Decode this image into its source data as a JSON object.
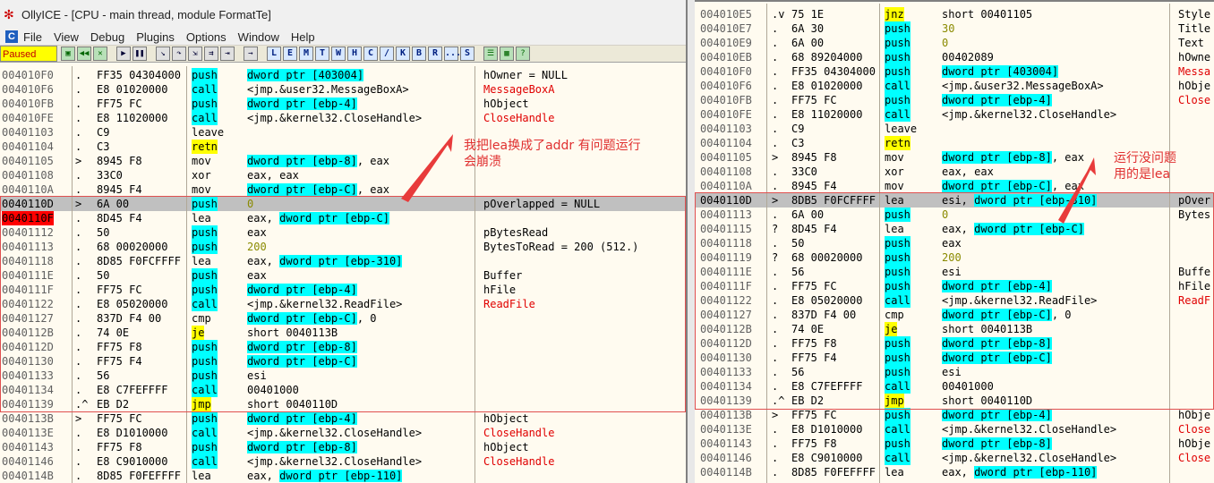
{
  "window": {
    "title": "OllyICE - [CPU - main thread, module FormatTe]",
    "menu": [
      "File",
      "View",
      "Debug",
      "Plugins",
      "Options",
      "Window",
      "Help"
    ],
    "status": "Paused",
    "toolbar_buttons": [
      "L",
      "E",
      "M",
      "T",
      "W",
      "H",
      "C",
      "/",
      "K",
      "B",
      "R",
      "...",
      "S"
    ]
  },
  "left_rows": [
    {
      "addr": "004010F0",
      "mk": ".",
      "hex": "FF35 04304000",
      "mn": "push",
      "op": "dword ptr [403004]",
      "cm": "hOwner = NULL"
    },
    {
      "addr": "004010F6",
      "mk": ".",
      "hex": "E8 01020000",
      "mn": "call",
      "op": "<jmp.&user32.MessageBoxA>",
      "cm": "MessageBoxA"
    },
    {
      "addr": "004010FB",
      "mk": ".",
      "hex": "FF75 FC",
      "mn": "push",
      "op": "dword ptr [ebp-4]",
      "cm": "hObject"
    },
    {
      "addr": "004010FE",
      "mk": ".",
      "hex": "E8 11020000",
      "mn": "call",
      "op": "<jmp.&kernel32.CloseHandle>",
      "cm": "CloseHandle"
    },
    {
      "addr": "00401103",
      "mk": ".",
      "hex": "C9",
      "mn": "leave",
      "op": "",
      "cm": ""
    },
    {
      "addr": "00401104",
      "mk": ".",
      "hex": "C3",
      "mn": "retn",
      "op": "",
      "cm": ""
    },
    {
      "addr": "00401105",
      "mk": ">",
      "hex": "8945 F8",
      "mn": "mov",
      "op": "dword ptr [ebp-8], eax",
      "cm": ""
    },
    {
      "addr": "00401108",
      "mk": ".",
      "hex": "33C0",
      "mn": "xor",
      "op": "eax, eax",
      "cm": ""
    },
    {
      "addr": "0040110A",
      "mk": ".",
      "hex": "8945 F4",
      "mn": "mov",
      "op": "dword ptr [ebp-C], eax",
      "cm": ""
    },
    {
      "addr": "0040110D",
      "mk": ">",
      "hex": "6A 00",
      "mn": "push",
      "op": "0",
      "cm": "pOverlapped = NULL"
    },
    {
      "addr": "0040110F",
      "mk": ".",
      "hex": "8D45 F4",
      "mn": "lea",
      "op": "eax, dword ptr [ebp-C]",
      "cm": ""
    },
    {
      "addr": "00401112",
      "mk": ".",
      "hex": "50",
      "mn": "push",
      "op": "eax",
      "cm": "pBytesRead"
    },
    {
      "addr": "00401113",
      "mk": ".",
      "hex": "68 00020000",
      "mn": "push",
      "op": "200",
      "cm": "BytesToRead = 200 (512.)"
    },
    {
      "addr": "00401118",
      "mk": ".",
      "hex": "8D85 F0FCFFFF",
      "mn": "lea",
      "op": "eax, dword ptr [ebp-310]",
      "cm": ""
    },
    {
      "addr": "0040111E",
      "mk": ".",
      "hex": "50",
      "mn": "push",
      "op": "eax",
      "cm": "Buffer"
    },
    {
      "addr": "0040111F",
      "mk": ".",
      "hex": "FF75 FC",
      "mn": "push",
      "op": "dword ptr [ebp-4]",
      "cm": "hFile"
    },
    {
      "addr": "00401122",
      "mk": ".",
      "hex": "E8 05020000",
      "mn": "call",
      "op": "<jmp.&kernel32.ReadFile>",
      "cm": "ReadFile"
    },
    {
      "addr": "00401127",
      "mk": ".",
      "hex": "837D F4 00",
      "mn": "cmp",
      "op": "dword ptr [ebp-C], 0",
      "cm": ""
    },
    {
      "addr": "0040112B",
      "mk": ".",
      "hex": "74 0E",
      "mn": "je",
      "op": "short 0040113B",
      "cm": ""
    },
    {
      "addr": "0040112D",
      "mk": ".",
      "hex": "FF75 F8",
      "mn": "push",
      "op": "dword ptr [ebp-8]",
      "cm": ""
    },
    {
      "addr": "00401130",
      "mk": ".",
      "hex": "FF75 F4",
      "mn": "push",
      "op": "dword ptr [ebp-C]",
      "cm": ""
    },
    {
      "addr": "00401133",
      "mk": ".",
      "hex": "56",
      "mn": "push",
      "op": "esi",
      "cm": ""
    },
    {
      "addr": "00401134",
      "mk": ".",
      "hex": "E8 C7FEFFFF",
      "mn": "call",
      "op": "00401000",
      "cm": ""
    },
    {
      "addr": "00401139",
      "mk": ".^",
      "hex": "EB D2",
      "mn": "jmp",
      "op": "short 0040110D",
      "cm": ""
    },
    {
      "addr": "0040113B",
      "mk": ">",
      "hex": "FF75 FC",
      "mn": "push",
      "op": "dword ptr [ebp-4]",
      "cm": "hObject"
    },
    {
      "addr": "0040113E",
      "mk": ".",
      "hex": "E8 D1010000",
      "mn": "call",
      "op": "<jmp.&kernel32.CloseHandle>",
      "cm": "CloseHandle"
    },
    {
      "addr": "00401143",
      "mk": ".",
      "hex": "FF75 F8",
      "mn": "push",
      "op": "dword ptr [ebp-8]",
      "cm": "hObject"
    },
    {
      "addr": "00401146",
      "mk": ".",
      "hex": "E8 C9010000",
      "mn": "call",
      "op": "<jmp.&kernel32.CloseHandle>",
      "cm": "CloseHandle"
    },
    {
      "addr": "0040114B",
      "mk": ".",
      "hex": "8D85 F0FEFFFF",
      "mn": "lea",
      "op": "eax, dword ptr [ebp-110]",
      "cm": ""
    }
  ],
  "right_rows": [
    {
      "addr": "004010E5",
      "mk": ".v",
      "hex": "75 1E",
      "mn": "jnz",
      "op": "short 00401105",
      "cm": "Style"
    },
    {
      "addr": "004010E7",
      "mk": ".",
      "hex": "6A 30",
      "mn": "push",
      "op": "30",
      "cm": "Title"
    },
    {
      "addr": "004010E9",
      "mk": ".",
      "hex": "6A 00",
      "mn": "push",
      "op": "0",
      "cm": "Text"
    },
    {
      "addr": "004010EB",
      "mk": ".",
      "hex": "68 89204000",
      "mn": "push",
      "op": "00402089",
      "cm": "hOwne"
    },
    {
      "addr": "004010F0",
      "mk": ".",
      "hex": "FF35 04304000",
      "mn": "push",
      "op": "dword ptr [403004]",
      "cm": "Messa"
    },
    {
      "addr": "004010F6",
      "mk": ".",
      "hex": "E8 01020000",
      "mn": "call",
      "op": "<jmp.&user32.MessageBoxA>",
      "cm": "hObje"
    },
    {
      "addr": "004010FB",
      "mk": ".",
      "hex": "FF75 FC",
      "mn": "push",
      "op": "dword ptr [ebp-4]",
      "cm": "Close"
    },
    {
      "addr": "004010FE",
      "mk": ".",
      "hex": "E8 11020000",
      "mn": "call",
      "op": "<jmp.&kernel32.CloseHandle>",
      "cm": ""
    },
    {
      "addr": "00401103",
      "mk": ".",
      "hex": "C9",
      "mn": "leave",
      "op": "",
      "cm": ""
    },
    {
      "addr": "00401104",
      "mk": ".",
      "hex": "C3",
      "mn": "retn",
      "op": "",
      "cm": ""
    },
    {
      "addr": "00401105",
      "mk": ">",
      "hex": "8945 F8",
      "mn": "mov",
      "op": "dword ptr [ebp-8], eax",
      "cm": ""
    },
    {
      "addr": "00401108",
      "mk": ".",
      "hex": "33C0",
      "mn": "xor",
      "op": "eax, eax",
      "cm": ""
    },
    {
      "addr": "0040110A",
      "mk": ".",
      "hex": "8945 F4",
      "mn": "mov",
      "op": "dword ptr [ebp-C], eax",
      "cm": ""
    },
    {
      "addr": "0040110D",
      "mk": ">",
      "hex": "8DB5 F0FCFFFF",
      "mn": "lea",
      "op": "esi, dword ptr [ebp-310]",
      "cm": "pOver"
    },
    {
      "addr": "00401113",
      "mk": ".",
      "hex": "6A 00",
      "mn": "push",
      "op": "0",
      "cm": "Bytes"
    },
    {
      "addr": "00401115",
      "mk": "?",
      "hex": "8D45 F4",
      "mn": "lea",
      "op": "eax, dword ptr [ebp-C]",
      "cm": ""
    },
    {
      "addr": "00401118",
      "mk": ".",
      "hex": "50",
      "mn": "push",
      "op": "eax",
      "cm": ""
    },
    {
      "addr": "00401119",
      "mk": "?",
      "hex": "68 00020000",
      "mn": "push",
      "op": "200",
      "cm": ""
    },
    {
      "addr": "0040111E",
      "mk": ".",
      "hex": "56",
      "mn": "push",
      "op": "esi",
      "cm": "Buffe"
    },
    {
      "addr": "0040111F",
      "mk": ".",
      "hex": "FF75 FC",
      "mn": "push",
      "op": "dword ptr [ebp-4]",
      "cm": "hFile"
    },
    {
      "addr": "00401122",
      "mk": ".",
      "hex": "E8 05020000",
      "mn": "call",
      "op": "<jmp.&kernel32.ReadFile>",
      "cm": "ReadF"
    },
    {
      "addr": "00401127",
      "mk": ".",
      "hex": "837D F4 00",
      "mn": "cmp",
      "op": "dword ptr [ebp-C], 0",
      "cm": ""
    },
    {
      "addr": "0040112B",
      "mk": ".",
      "hex": "74 0E",
      "mn": "je",
      "op": "short 0040113B",
      "cm": ""
    },
    {
      "addr": "0040112D",
      "mk": ".",
      "hex": "FF75 F8",
      "mn": "push",
      "op": "dword ptr [ebp-8]",
      "cm": ""
    },
    {
      "addr": "00401130",
      "mk": ".",
      "hex": "FF75 F4",
      "mn": "push",
      "op": "dword ptr [ebp-C]",
      "cm": ""
    },
    {
      "addr": "00401133",
      "mk": ".",
      "hex": "56",
      "mn": "push",
      "op": "esi",
      "cm": ""
    },
    {
      "addr": "00401134",
      "mk": ".",
      "hex": "E8 C7FEFFFF",
      "mn": "call",
      "op": "00401000",
      "cm": ""
    },
    {
      "addr": "00401139",
      "mk": ".^",
      "hex": "EB D2",
      "mn": "jmp",
      "op": "short 0040110D",
      "cm": ""
    },
    {
      "addr": "0040113B",
      "mk": ">",
      "hex": "FF75 FC",
      "mn": "push",
      "op": "dword ptr [ebp-4]",
      "cm": "hObje"
    },
    {
      "addr": "0040113E",
      "mk": ".",
      "hex": "E8 D1010000",
      "mn": "call",
      "op": "<jmp.&kernel32.CloseHandle>",
      "cm": "Close"
    },
    {
      "addr": "00401143",
      "mk": ".",
      "hex": "FF75 F8",
      "mn": "push",
      "op": "dword ptr [ebp-8]",
      "cm": "hObje"
    },
    {
      "addr": "00401146",
      "mk": ".",
      "hex": "E8 C9010000",
      "mn": "call",
      "op": "<jmp.&kernel32.CloseHandle>",
      "cm": "Close"
    },
    {
      "addr": "0040114B",
      "mk": ".",
      "hex": "8D85 F0FEFFFF",
      "mn": "lea",
      "op": "eax, dword ptr [ebp-110]",
      "cm": ""
    }
  ],
  "annotations": {
    "left": "我把lea换成了addr 有问题运行\n会崩溃",
    "right": "运行没问题\n用的是lea"
  },
  "colors": {
    "highlight": "#00ffff",
    "jump_highlight": "#ffff00",
    "api_red": "#e00000",
    "current_eip": "#ff0000",
    "annotation": "#e03030"
  }
}
